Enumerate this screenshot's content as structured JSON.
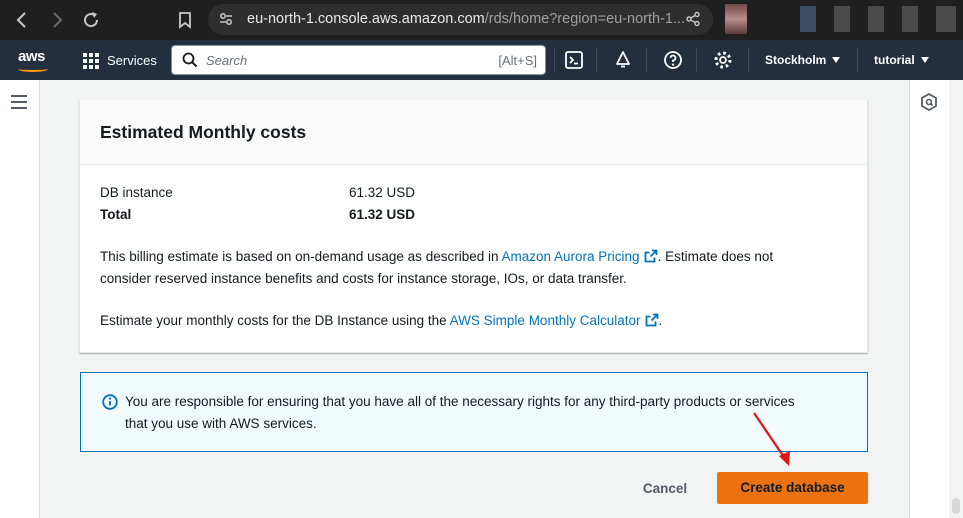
{
  "browser": {
    "url_host": "eu-north-1.console.aws.amazon.com",
    "url_path": "/rds/home?region=eu-north-1..."
  },
  "aws_nav": {
    "logo_text": "aws",
    "services_label": "Services",
    "search_placeholder": "Search",
    "search_shortcut": "[Alt+S]",
    "region_label": "Stockholm",
    "account_label": "tutorial",
    "icons": [
      "cloudshell-icon",
      "notifications-icon",
      "help-icon",
      "settings-icon"
    ]
  },
  "cost_panel": {
    "title": "Estimated Monthly costs",
    "rows": [
      {
        "label": "DB instance",
        "value": "61.32 USD"
      },
      {
        "label": "Total",
        "value": "61.32 USD"
      }
    ],
    "billing_text_1": "This billing estimate is based on on-demand usage as described in ",
    "billing_link": "Amazon Aurora Pricing",
    "billing_text_2": ". Estimate does not",
    "billing_text_3": "consider reserved instance benefits and costs for instance storage, IOs, or data transfer.",
    "calc_text": "Estimate your monthly costs for the DB Instance using the ",
    "calc_link": "AWS Simple Monthly Calculator",
    "calc_end": "."
  },
  "alert": {
    "line1": "You are responsible for ensuring that you have all of the necessary rights for any third-party products or services",
    "line2": "that you use with AWS services."
  },
  "actions": {
    "cancel_label": "Cancel",
    "create_label": "Create database"
  },
  "colors": {
    "aws_nav_bg": "#232f3e",
    "primary_button": "#ec7211",
    "link": "#0073bb",
    "info_border": "#0073bb",
    "annotation_arrow": "#e01515"
  }
}
